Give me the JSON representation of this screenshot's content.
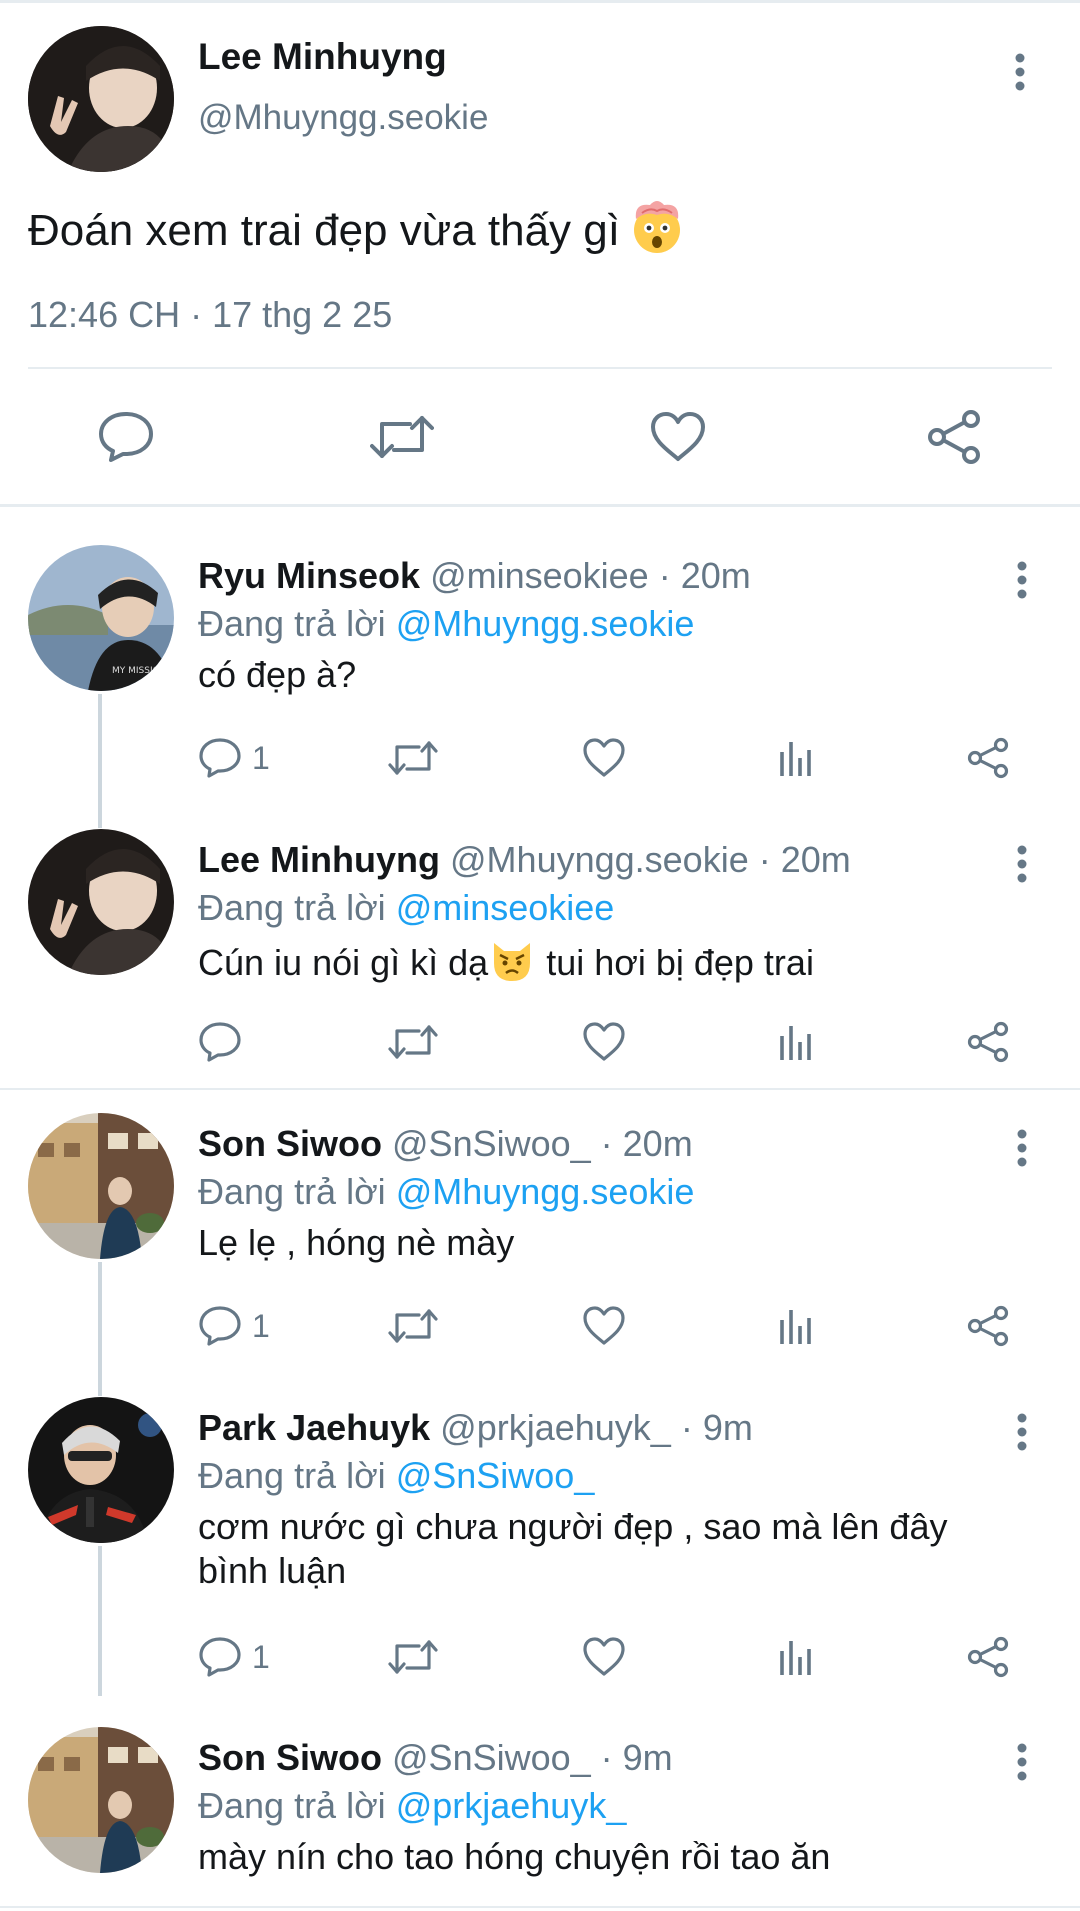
{
  "main_tweet": {
    "name": "Lee Minhuyng",
    "handle": "@Mhuyngg.seokie",
    "text": "Đoán xem trai đẹp vừa thấy gì",
    "emoji": "exploding-head-emoji",
    "timestamp": "12:46 CH · 17 thg 2 25",
    "actions": [
      "reply-icon",
      "retweet-icon",
      "like-icon",
      "share-icon"
    ]
  },
  "replies": [
    {
      "name": "Ryu Minseok",
      "handle": "@minseokiee · 20m",
      "replying_prefix": "Đang trả lời ",
      "replying_to": "@Mhuyngg.seokie",
      "text": "có đẹp à?",
      "reply_count": "1",
      "avatar_colors": [
        "#9fb6cf",
        "#2a2a2a"
      ]
    },
    {
      "name": "Lee Minhuyng",
      "handle": "@Mhuyngg.seokie · 20m",
      "replying_prefix": "Đang trả lời ",
      "replying_to": "@minseokiee",
      "text_before": "Cún iu nói gì kì dạ",
      "text_after": " tui hơi bị đẹp trai",
      "emoji": "pouting-cat-emoji",
      "reply_count": "",
      "avatar_colors": [
        "#e8d3c2",
        "#2a2522"
      ]
    },
    {
      "name": "Son Siwoo",
      "handle": "@SnSiwoo_ · 20m",
      "replying_prefix": "Đang trả lời ",
      "replying_to": "@Mhuyngg.seokie",
      "text": "Lẹ lẹ , hóng nè mày",
      "reply_count": "1",
      "avatar_colors": [
        "#c9b38f",
        "#2f3f4f"
      ]
    },
    {
      "name": "Park Jaehuyk",
      "handle": "@prkjaehuyk_ · 9m",
      "replying_prefix": "Đang trả lời ",
      "replying_to": "@SnSiwoo_",
      "text": "cơm nước gì chưa người đẹp , sao mà lên đây bình luận",
      "reply_count": "1",
      "avatar_colors": [
        "#1a1a1a",
        "#c0392b"
      ]
    },
    {
      "name": "Son Siwoo",
      "handle": "@SnSiwoo_ · 9m",
      "replying_prefix": "Đang trả lời ",
      "replying_to": "@prkjaehuyk_",
      "text": "mày nín cho tao hóng chuyện rồi tao ăn",
      "reply_count": "",
      "avatar_colors": [
        "#c9b38f",
        "#2f3f4f"
      ]
    }
  ],
  "colors": {
    "text": "#14171a",
    "secondary": "#657786",
    "link": "#1da1f2",
    "divider": "#e6ecf0",
    "thread_line": "#ccd6dd"
  }
}
